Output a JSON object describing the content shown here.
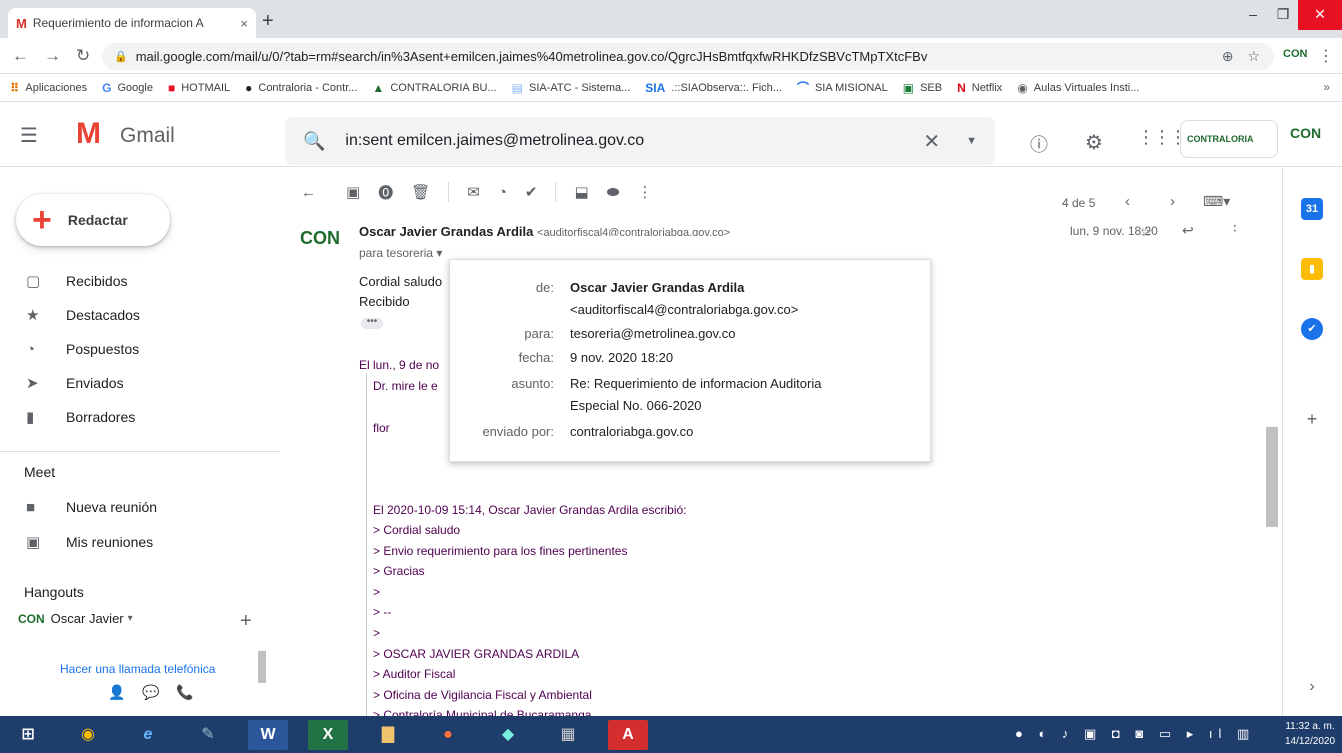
{
  "browser": {
    "tab_title": "Requerimiento de informacion A",
    "tab_close": "×",
    "new_tab": "+",
    "url": "mail.google.com/mail/u/0/?tab=rm#search/in%3Asent+emilcen.jaimes%40metrolinea.gov.co/QgrcJHsBmtfqxfwRHKDfzSBVcTMpTXtcFBv",
    "extension_label": "CON",
    "bookmarks": [
      {
        "icon": "apps-icon",
        "glyph": "⠿",
        "color": "#e37400",
        "label": "Aplicaciones"
      },
      {
        "icon": "google-icon",
        "glyph": "G",
        "color": "#4285f4",
        "label": "Google"
      },
      {
        "icon": "windows-icon",
        "glyph": "■",
        "color": "#e81123",
        "label": "HOTMAIL"
      },
      {
        "icon": "contraloria-icon",
        "glyph": "●",
        "color": "#222222",
        "label": "Contraloria - Contr..."
      },
      {
        "icon": "contraloria-bu-icon",
        "glyph": "▲",
        "color": "#1d6b2c",
        "label": "CONTRALORIA BU..."
      },
      {
        "icon": "doc-icon",
        "glyph": "▤",
        "color": "#8ab4f8",
        "label": "SIA-ATC - Sistema..."
      },
      {
        "icon": "sia-icon",
        "glyph": "SIA",
        "color": "#1a73e8",
        "label": ".::SIAObserva::. Fich..."
      },
      {
        "icon": "sia-misional-icon",
        "glyph": "⌒",
        "color": "#1a73e8",
        "label": "SIA MISIONAL"
      },
      {
        "icon": "seb-icon",
        "glyph": "▣",
        "color": "#188038",
        "label": "SEB"
      },
      {
        "icon": "netflix-icon",
        "glyph": "N",
        "color": "#e50914",
        "label": "Netflix"
      },
      {
        "icon": "aulas-icon",
        "glyph": "◉",
        "color": "#5f6368",
        "label": "Aulas Virtuales Insti..."
      }
    ]
  },
  "gmail": {
    "app_name": "Gmail",
    "search_value": "in:sent emilcen.jaimes@metrolinea.gov.co",
    "badge_text": "CONTRALORIA",
    "avatar_text": "CON",
    "compose_label": "Redactar",
    "nav": [
      {
        "icon": "inbox-icon",
        "glyph": "▢",
        "label": "Recibidos"
      },
      {
        "icon": "star-icon",
        "glyph": "★",
        "label": "Destacados"
      },
      {
        "icon": "clock-icon",
        "glyph": "◔",
        "label": "Pospuestos"
      },
      {
        "icon": "send-icon",
        "glyph": "➤",
        "label": "Enviados"
      },
      {
        "icon": "draft-icon",
        "glyph": "▮",
        "label": "Borradores"
      }
    ],
    "meet_title": "Meet",
    "meet": [
      {
        "icon": "video-icon",
        "glyph": "■",
        "label": "Nueva reunión"
      },
      {
        "icon": "calendar-icon",
        "glyph": "▣",
        "label": "Mis reuniones"
      }
    ],
    "hangouts_title": "Hangouts",
    "hangout_user": "Oscar Javier",
    "call_link": "Hacer una llamada telefónica",
    "pager": "4 de 5"
  },
  "message": {
    "sender": "Oscar Javier Grandas Ardila",
    "sender_email": "<auditorfiscal4@contraloriabga.gov.co>",
    "date": "lun, 9 nov. 18:20",
    "to": "para tesoreria",
    "body": [
      "Cordial saludo",
      "Recibido"
    ],
    "quote_intro": "El lun., 9 de no",
    "quote_lines": [
      "Dr. mire le e",
      "flor"
    ],
    "thread_header": "El 2020-10-09 15:14, Oscar Javier Grandas Ardila escribió:",
    "thread": [
      "> Cordial saludo",
      "> Envio requerimiento para los fines pertinentes",
      "> Gracias",
      ">",
      "> --",
      ">",
      "> OSCAR JAVIER GRANDAS ARDILA",
      "> Auditor Fiscal",
      "> Oficina de Vigilancia Fiscal y Ambiental",
      "> Contraloría Municipal de Bucaramanga"
    ]
  },
  "popup": {
    "from_label": "de:",
    "from_name": "Oscar Javier Grandas Ardila",
    "from_email": "<auditorfiscal4@contraloriabga.gov.co>",
    "to_label": "para:",
    "to_value": "tesoreria@metrolinea.gov.co",
    "date_label": "fecha:",
    "date_value": "9 nov. 2020 18:20",
    "subject_label": "asunto:",
    "subject_line1": "Re: Requerimiento de informacion Auditoria",
    "subject_line2": "Especial No. 066-2020",
    "sentby_label": "enviado por:",
    "sentby_value": "contraloriabga.gov.co"
  },
  "taskbar": {
    "clock_time": "11:32 a. m.",
    "clock_date": "14/12/2020"
  }
}
